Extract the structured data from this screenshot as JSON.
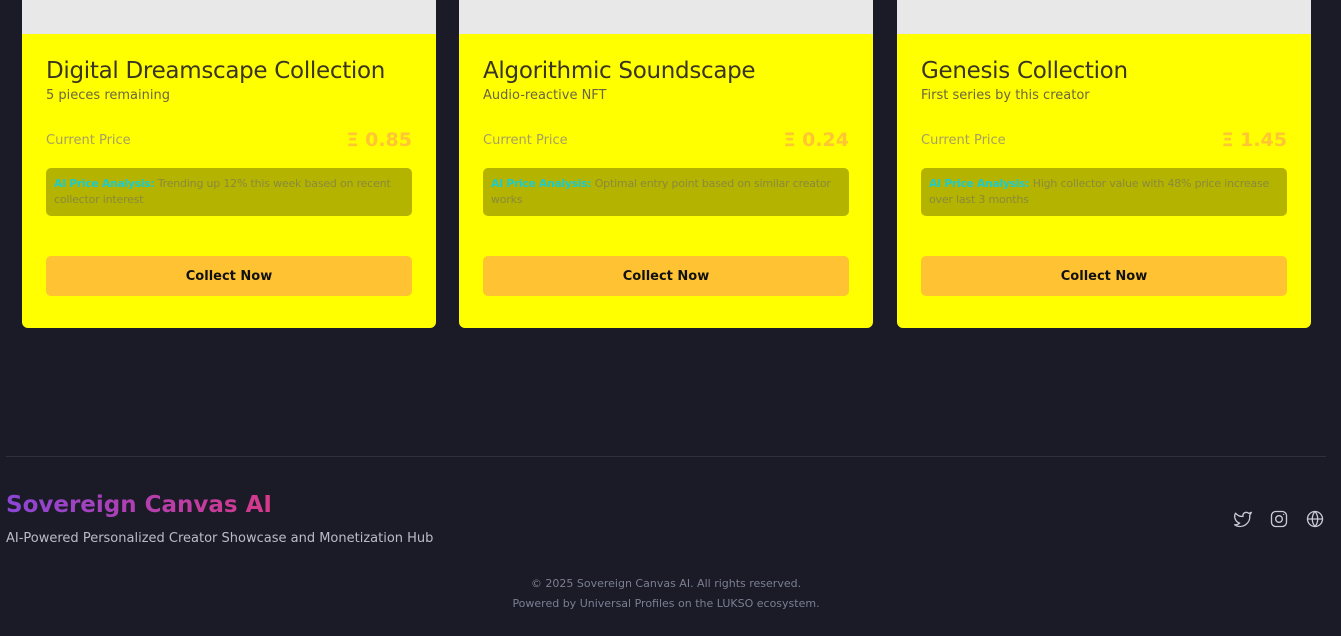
{
  "cards": [
    {
      "title": "Digital Dreamscape Collection",
      "subtitle": "5 pieces remaining",
      "price_label": "Current Price",
      "price": "Ξ 0.85",
      "ai_label": "AI Price Analysis:",
      "ai_text": "Trending up 12% this week based on recent collector interest",
      "button": "Collect Now"
    },
    {
      "title": "Algorithmic Soundscape",
      "subtitle": "Audio-reactive NFT",
      "price_label": "Current Price",
      "price": "Ξ 0.24",
      "ai_label": "AI Price Analysis:",
      "ai_text": "Optimal entry point based on similar creator works",
      "button": "Collect Now"
    },
    {
      "title": "Genesis Collection",
      "subtitle": "First series by this creator",
      "price_label": "Current Price",
      "price": "Ξ 1.45",
      "ai_label": "AI Price Analysis:",
      "ai_text": "High collector value with 48% price increase over last 3 months",
      "button": "Collect Now"
    }
  ],
  "footer": {
    "brand": "Sovereign Canvas AI",
    "tagline": "AI-Powered Personalized Creator Showcase and Monetization Hub",
    "socials": [
      "twitter-icon",
      "instagram-icon",
      "globe-icon"
    ],
    "copyright": "© 2025 Sovereign Canvas AI. All rights reserved.",
    "powered_by": "Powered by Universal Profiles on the LUKSO ecosystem."
  },
  "colors": {
    "background": "#1a1b26",
    "card": "#ffff00",
    "accent": "#ffc233",
    "ai_label": "#1ecbc8"
  }
}
